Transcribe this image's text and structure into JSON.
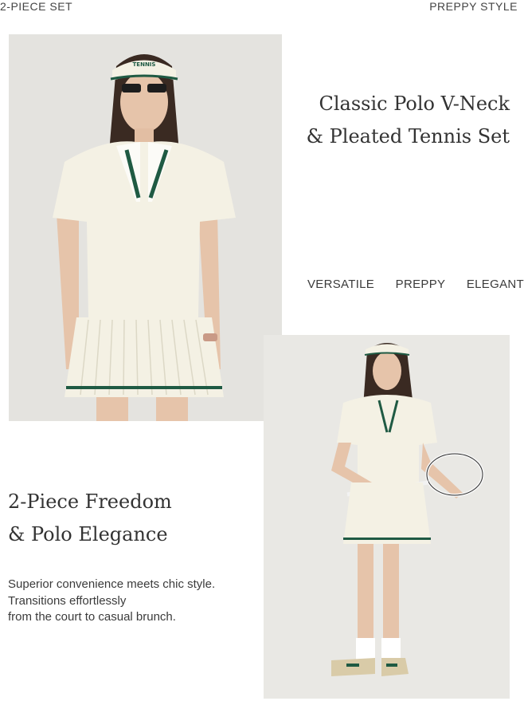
{
  "header": {
    "left_label": "2-PIECE SET",
    "right_label": "PREPPY STYLE"
  },
  "hero": {
    "title_line1": "Classic Polo V-Neck",
    "title_line2": "& Pleated Tennis Set",
    "visor_text": "TENNIS"
  },
  "tags": [
    "VERSATILE",
    "PREPPY",
    "ELEGANT"
  ],
  "feature": {
    "title_line1": "2-Piece Freedom",
    "title_line2": "& Polo Elegance",
    "body_lines": [
      "Superior convenience meets chic style.",
      "Transitions effortlessly",
      "from the court to casual brunch."
    ]
  },
  "colors": {
    "accent_green": "#1f5a43",
    "garment_cream": "#f4f1e4",
    "background_grey": "#e4e3df"
  }
}
